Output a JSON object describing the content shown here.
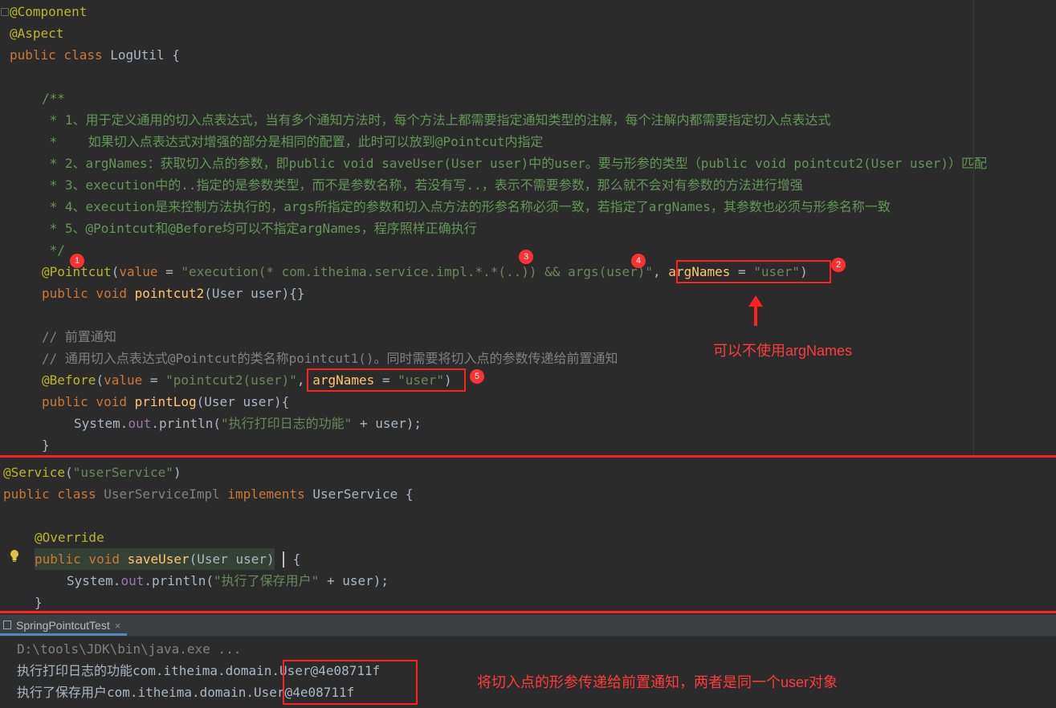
{
  "editor_top": {
    "lines": {
      "l1": "@Component",
      "l2": "@Aspect",
      "l3_kw": "public class ",
      "l3_name": "LogUtil {",
      "c0": "/**",
      "c1": " * 1、用于定义通用的切入点表达式，当有多个通知方法时，每个方法上都需要指定通知类型的注解，每个注解内都需要指定切入点表达式",
      "c2": " *    如果切入点表达式对增强的部分是相同的配置，此时可以放到@Pointcut内指定",
      "c3": " * 2、argNames：获取切入点的参数，即public void saveUser(User user)中的user。要与形参的类型（public void pointcut2(User user)）匹配",
      "c4": " * 3、execution中的..指定的是参数类型，而不是参数名称，若没有写..，表示不需要参数，那么就不会对有参数的方法进行增强",
      "c5": " * 4、execution是来控制方法执行的，args所指定的参数和切入点方法的形参名称必须一致，若指定了argNames，其参数也必须与形参名称一致",
      "c6": " * 5、@Pointcut和@Before均可以不指定argNames，程序照样正确执行",
      "c7": " */",
      "p1_ann": "@Pointcut",
      "p1_a": "(",
      "p1_b": "value",
      "p1_c": " = ",
      "p1_str": "\"execution(* com.itheima.service.impl.*.*(..)) && args(user)\"",
      "p1_d": ", ",
      "p1_e": "argNames",
      "p1_f": " = ",
      "p1_str2": "\"user\"",
      "p1_g": ")",
      "p2_kw": "public void ",
      "p2_fn": "pointcut2",
      "p2_rest": "(User user){}",
      "lc1": "// 前置通知",
      "lc2": "// 通用切入点表达式@Pointcut的类名称pointcut1()。同时需要将切入点的参数传递给前置通知",
      "b1_ann": "@Before",
      "b1_a": "(",
      "b1_b": "value",
      "b1_c": " = ",
      "b1_str": "\"pointcut2(user)\"",
      "b1_d": ", ",
      "b1_e": "argNames",
      "b1_f": " = ",
      "b1_str2": "\"user\"",
      "b1_g": ")",
      "pl_kw": "public void ",
      "pl_fn": "printLog",
      "pl_rest": "(User user){",
      "sys_a": "System.",
      "sys_out": "out",
      "sys_b": ".println(",
      "sys_str": "\"执行打印日志的功能\"",
      "sys_c": " + user);",
      "close": "}"
    }
  },
  "editor_bottom": {
    "s1_ann": "@Service",
    "s1_rest": "(",
    "s1_str": "\"userService\"",
    "s1_end": ")",
    "s2_kw": "public class ",
    "s2_name": "UserServiceImpl",
    "s2_impl": " implements ",
    "s2_iface": "UserService {",
    "ov": "@Override",
    "su_kw": "public void ",
    "su_fn": "saveUser",
    "su_rest": "(User user)",
    "su_brace": " {",
    "sy_a": "System.",
    "sy_out": "out",
    "sy_b": ".println(",
    "sy_str": "\"执行了保存用户\"",
    "sy_c": " + user);",
    "close": "}"
  },
  "console": {
    "tab_label": "SpringPointcutTest",
    "tab_close": "×",
    "out1": "D:\\tools\\JDK\\bin\\java.exe ...",
    "out2": "执行打印日志的功能com.itheima.domain.User@4e08711f",
    "out3": "执行了保存用户com.itheima.domain.User@4e08711f"
  },
  "annotations": {
    "badge1": "1",
    "badge2": "2",
    "badge3": "3",
    "badge4": "4",
    "badge5": "5",
    "note1": "可以不使用argNames",
    "note2": "将切入点的形参传递给前置通知，两者是同一个user对象"
  },
  "colors": {
    "background": "#2b2b2b",
    "annotation_red": "#ff2020",
    "keyword": "#cc7832",
    "string": "#6a8759",
    "doc_comment": "#629755"
  }
}
